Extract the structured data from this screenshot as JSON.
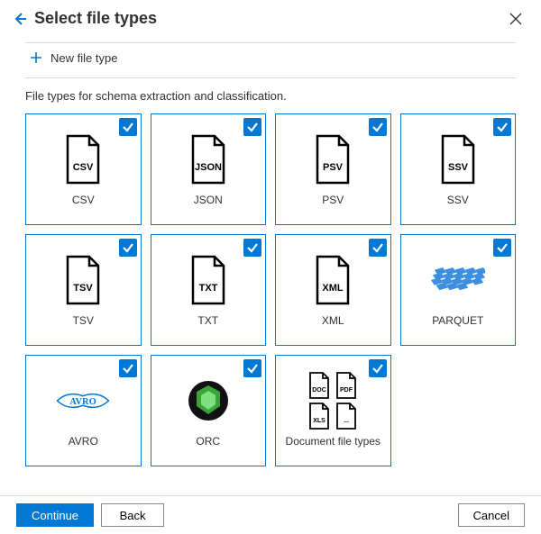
{
  "title": "Select file types",
  "new_file_type_label": "New file type",
  "description": "File types for schema extraction and classification.",
  "tiles": [
    {
      "label": "CSV",
      "tag": "CSV",
      "kind": "page",
      "checked": true
    },
    {
      "label": "JSON",
      "tag": "JSON",
      "kind": "page",
      "checked": true
    },
    {
      "label": "PSV",
      "tag": "PSV",
      "kind": "page",
      "checked": true
    },
    {
      "label": "SSV",
      "tag": "SSV",
      "kind": "page",
      "checked": true
    },
    {
      "label": "TSV",
      "tag": "TSV",
      "kind": "page",
      "checked": true
    },
    {
      "label": "TXT",
      "tag": "TXT",
      "kind": "page",
      "checked": true
    },
    {
      "label": "XML",
      "tag": "XML",
      "kind": "page",
      "checked": true
    },
    {
      "label": "PARQUET",
      "kind": "parquet",
      "checked": true
    },
    {
      "label": "AVRO",
      "kind": "avro",
      "checked": true
    },
    {
      "label": "ORC",
      "kind": "orc",
      "checked": true
    },
    {
      "label": "Document file types",
      "kind": "docs",
      "doc_tags": [
        "DOC",
        "PDF",
        "XLS",
        "..."
      ],
      "checked": true
    }
  ],
  "buttons": {
    "continue": "Continue",
    "back": "Back",
    "cancel": "Cancel"
  },
  "colors": {
    "accent": "#0078d4"
  }
}
